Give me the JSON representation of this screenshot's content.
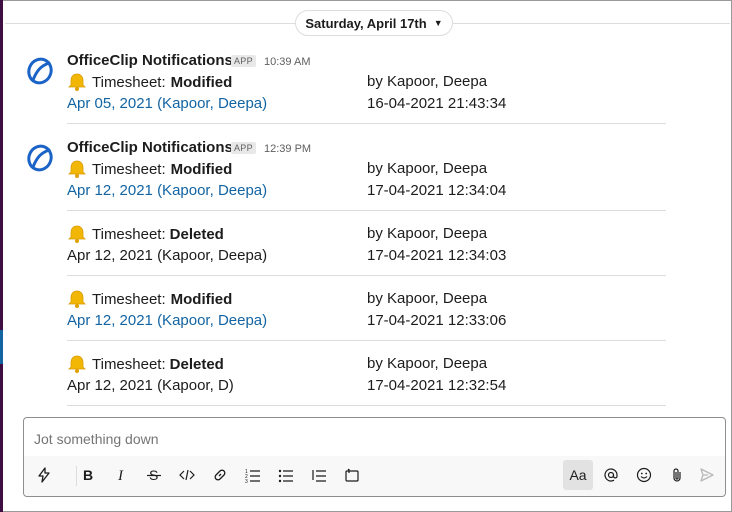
{
  "date_divider": {
    "label": "Saturday, April 17th"
  },
  "messages": [
    {
      "sender": "OfficeClip Notifications",
      "badge": "APP",
      "time": "10:39 AM",
      "entries": [
        {
          "type_label": "Timesheet:",
          "action": "Modified",
          "by": "by Kapoor, Deepa",
          "link": "Apr 05, 2021 (Kapoor, Deepa)",
          "stamp": "16-04-2021 21:43:34"
        }
      ]
    },
    {
      "sender": "OfficeClip Notifications",
      "badge": "APP",
      "time": "12:39 PM",
      "entries": [
        {
          "type_label": "Timesheet:",
          "action": "Modified",
          "by": "by Kapoor, Deepa",
          "link": "Apr 12, 2021 (Kapoor, Deepa)",
          "stamp": "17-04-2021 12:34:04"
        },
        {
          "type_label": "Timesheet:",
          "action": "Deleted",
          "by": "by Kapoor, Deepa",
          "link": "Apr 12, 2021 (Kapoor, Deepa)",
          "stamp": "17-04-2021 12:34:03"
        },
        {
          "type_label": "Timesheet:",
          "action": "Modified",
          "by": "by Kapoor, Deepa",
          "link": "Apr 12, 2021 (Kapoor, Deepa)",
          "stamp": "17-04-2021 12:33:06"
        },
        {
          "type_label": "Timesheet:",
          "action": "Deleted",
          "by": "by Kapoor, Deepa",
          "link": "Apr 12, 2021 (Kapoor, D)",
          "stamp": "17-04-2021 12:32:54"
        }
      ]
    }
  ],
  "composer": {
    "placeholder": "Jot something down",
    "tools": [
      "lightning-icon",
      "bold-icon",
      "italic-icon",
      "strikethrough-icon",
      "code-icon",
      "link-icon",
      "numbered-list-icon",
      "bulleted-list-icon",
      "blockquote-icon",
      "code-block-icon",
      "formatting-icon",
      "mention-icon",
      "emoji-icon",
      "attachment-icon",
      "send-icon"
    ],
    "format_label": "Aa"
  },
  "colors": {
    "link": "#1264a3",
    "sidebar": "#3f0e40",
    "bell": "#f2b705"
  }
}
